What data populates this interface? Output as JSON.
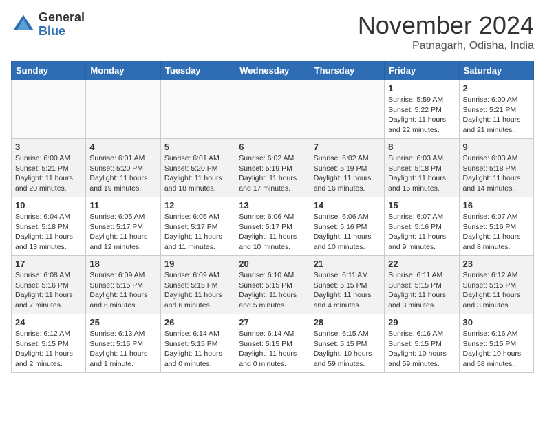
{
  "header": {
    "logo_general": "General",
    "logo_blue": "Blue",
    "month_title": "November 2024",
    "location": "Patnagarh, Odisha, India"
  },
  "days_of_week": [
    "Sunday",
    "Monday",
    "Tuesday",
    "Wednesday",
    "Thursday",
    "Friday",
    "Saturday"
  ],
  "weeks": [
    {
      "shaded": false,
      "days": [
        {
          "num": "",
          "info": ""
        },
        {
          "num": "",
          "info": ""
        },
        {
          "num": "",
          "info": ""
        },
        {
          "num": "",
          "info": ""
        },
        {
          "num": "",
          "info": ""
        },
        {
          "num": "1",
          "info": "Sunrise: 5:59 AM\nSunset: 5:22 PM\nDaylight: 11 hours\nand 22 minutes."
        },
        {
          "num": "2",
          "info": "Sunrise: 6:00 AM\nSunset: 5:21 PM\nDaylight: 11 hours\nand 21 minutes."
        }
      ]
    },
    {
      "shaded": true,
      "days": [
        {
          "num": "3",
          "info": "Sunrise: 6:00 AM\nSunset: 5:21 PM\nDaylight: 11 hours\nand 20 minutes."
        },
        {
          "num": "4",
          "info": "Sunrise: 6:01 AM\nSunset: 5:20 PM\nDaylight: 11 hours\nand 19 minutes."
        },
        {
          "num": "5",
          "info": "Sunrise: 6:01 AM\nSunset: 5:20 PM\nDaylight: 11 hours\nand 18 minutes."
        },
        {
          "num": "6",
          "info": "Sunrise: 6:02 AM\nSunset: 5:19 PM\nDaylight: 11 hours\nand 17 minutes."
        },
        {
          "num": "7",
          "info": "Sunrise: 6:02 AM\nSunset: 5:19 PM\nDaylight: 11 hours\nand 16 minutes."
        },
        {
          "num": "8",
          "info": "Sunrise: 6:03 AM\nSunset: 5:18 PM\nDaylight: 11 hours\nand 15 minutes."
        },
        {
          "num": "9",
          "info": "Sunrise: 6:03 AM\nSunset: 5:18 PM\nDaylight: 11 hours\nand 14 minutes."
        }
      ]
    },
    {
      "shaded": false,
      "days": [
        {
          "num": "10",
          "info": "Sunrise: 6:04 AM\nSunset: 5:18 PM\nDaylight: 11 hours\nand 13 minutes."
        },
        {
          "num": "11",
          "info": "Sunrise: 6:05 AM\nSunset: 5:17 PM\nDaylight: 11 hours\nand 12 minutes."
        },
        {
          "num": "12",
          "info": "Sunrise: 6:05 AM\nSunset: 5:17 PM\nDaylight: 11 hours\nand 11 minutes."
        },
        {
          "num": "13",
          "info": "Sunrise: 6:06 AM\nSunset: 5:17 PM\nDaylight: 11 hours\nand 10 minutes."
        },
        {
          "num": "14",
          "info": "Sunrise: 6:06 AM\nSunset: 5:16 PM\nDaylight: 11 hours\nand 10 minutes."
        },
        {
          "num": "15",
          "info": "Sunrise: 6:07 AM\nSunset: 5:16 PM\nDaylight: 11 hours\nand 9 minutes."
        },
        {
          "num": "16",
          "info": "Sunrise: 6:07 AM\nSunset: 5:16 PM\nDaylight: 11 hours\nand 8 minutes."
        }
      ]
    },
    {
      "shaded": true,
      "days": [
        {
          "num": "17",
          "info": "Sunrise: 6:08 AM\nSunset: 5:16 PM\nDaylight: 11 hours\nand 7 minutes."
        },
        {
          "num": "18",
          "info": "Sunrise: 6:09 AM\nSunset: 5:15 PM\nDaylight: 11 hours\nand 6 minutes."
        },
        {
          "num": "19",
          "info": "Sunrise: 6:09 AM\nSunset: 5:15 PM\nDaylight: 11 hours\nand 6 minutes."
        },
        {
          "num": "20",
          "info": "Sunrise: 6:10 AM\nSunset: 5:15 PM\nDaylight: 11 hours\nand 5 minutes."
        },
        {
          "num": "21",
          "info": "Sunrise: 6:11 AM\nSunset: 5:15 PM\nDaylight: 11 hours\nand 4 minutes."
        },
        {
          "num": "22",
          "info": "Sunrise: 6:11 AM\nSunset: 5:15 PM\nDaylight: 11 hours\nand 3 minutes."
        },
        {
          "num": "23",
          "info": "Sunrise: 6:12 AM\nSunset: 5:15 PM\nDaylight: 11 hours\nand 3 minutes."
        }
      ]
    },
    {
      "shaded": false,
      "days": [
        {
          "num": "24",
          "info": "Sunrise: 6:12 AM\nSunset: 5:15 PM\nDaylight: 11 hours\nand 2 minutes."
        },
        {
          "num": "25",
          "info": "Sunrise: 6:13 AM\nSunset: 5:15 PM\nDaylight: 11 hours\nand 1 minute."
        },
        {
          "num": "26",
          "info": "Sunrise: 6:14 AM\nSunset: 5:15 PM\nDaylight: 11 hours\nand 0 minutes."
        },
        {
          "num": "27",
          "info": "Sunrise: 6:14 AM\nSunset: 5:15 PM\nDaylight: 11 hours\nand 0 minutes."
        },
        {
          "num": "28",
          "info": "Sunrise: 6:15 AM\nSunset: 5:15 PM\nDaylight: 10 hours\nand 59 minutes."
        },
        {
          "num": "29",
          "info": "Sunrise: 6:16 AM\nSunset: 5:15 PM\nDaylight: 10 hours\nand 59 minutes."
        },
        {
          "num": "30",
          "info": "Sunrise: 6:16 AM\nSunset: 5:15 PM\nDaylight: 10 hours\nand 58 minutes."
        }
      ]
    }
  ]
}
